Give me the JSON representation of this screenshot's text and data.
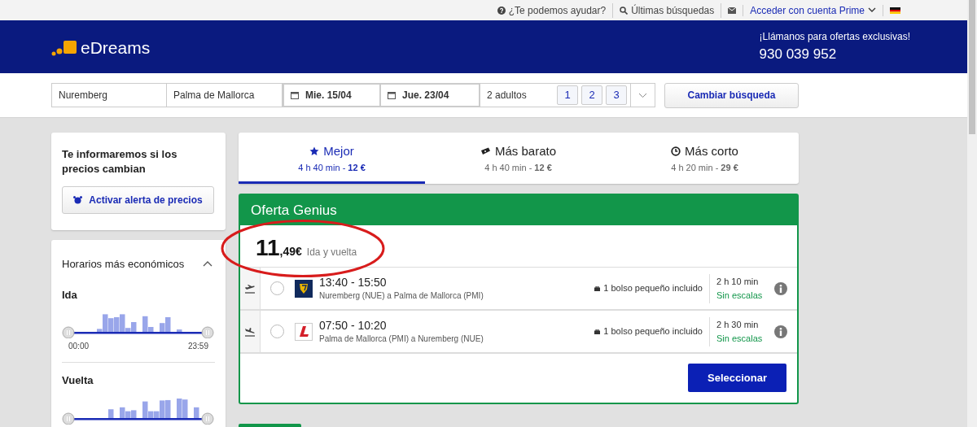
{
  "top_bar": {
    "help": "¿Te podemos ayudar?",
    "recent": "Últimas búsquedas",
    "account": "Acceder con cuenta Prime"
  },
  "header": {
    "brand": "eDreams",
    "promo": "¡Llámanos para ofertas exclusivas!",
    "phone": "930 039 952"
  },
  "search": {
    "origin": "Nuremberg",
    "destination": "Palma de Mallorca",
    "departure": "Mie. 15/04",
    "return": "Jue. 23/04",
    "passengers": "2 adultos",
    "passenger_options": [
      "1",
      "2",
      "3"
    ],
    "submit": "Cambiar búsqueda"
  },
  "price_alert": {
    "text": "Te informaremos si los precios cambian",
    "button": "Activar alerta de precios"
  },
  "schedule_filter": {
    "title": "Horarios más económicos",
    "expanded": true,
    "legs": [
      {
        "label": "Ida",
        "from": "00:00",
        "to": "23:59"
      },
      {
        "label": "Vuelta"
      }
    ]
  },
  "sort_tabs": [
    {
      "kind": "best",
      "label": "Mejor",
      "summary": "4 h 40 min - **12 €**",
      "selected": true
    },
    {
      "kind": "cheapest",
      "label": "Más barato",
      "summary": "4 h 40 min - **12 €**",
      "selected": false
    },
    {
      "kind": "shortest",
      "label": "Más corto",
      "summary": "4 h 20 min - **29 €**",
      "selected": false
    }
  ],
  "offer": {
    "title": "Oferta Genius",
    "price_whole": "11",
    "price_cents": ",49€",
    "price_note": "Ida y vuelta",
    "flights": [
      {
        "kind": "outbound",
        "logo": {
          "kind": "harp"
        },
        "times": "13:40 - 15:50",
        "route": "Nuremberg (NUE) a Palma de Mallorca (PMI)",
        "baggage": "1 bolso pequeño incluido",
        "duration": "2 h 10 min",
        "stops": "Sin escalas",
        "selected": false
      },
      {
        "kind": "return",
        "logo": {
          "kind": "letter"
        },
        "times": "07:50 - 10:20",
        "route": "Palma de Mallorca (PMI) a Nuremberg (NUE)",
        "baggage": "1 bolso pequeño incluido",
        "duration": "2 h 30 min",
        "stops": "Sin escalas",
        "selected": false
      }
    ],
    "button": "Seleccionar"
  }
}
